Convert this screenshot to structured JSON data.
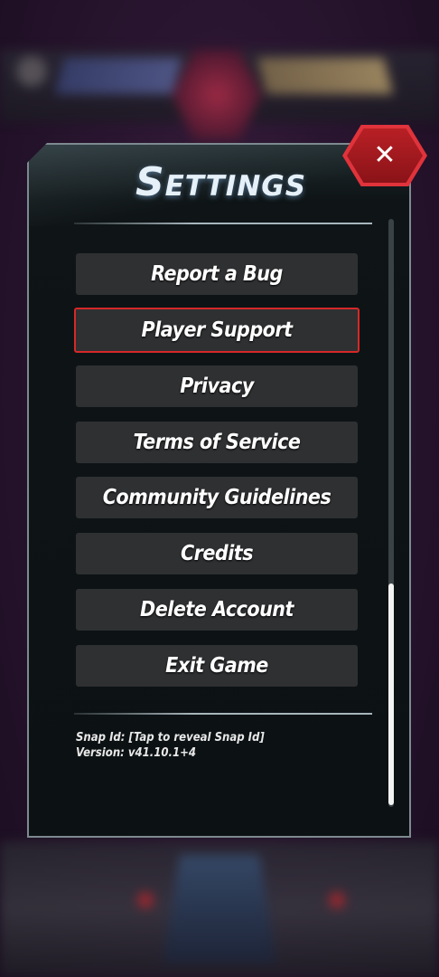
{
  "settings": {
    "title": "Settings",
    "close_symbol": "✕",
    "menu": [
      {
        "label": "Report a Bug",
        "selected": false
      },
      {
        "label": "Player Support",
        "selected": true
      },
      {
        "label": "Privacy",
        "selected": false
      },
      {
        "label": "Terms of Service",
        "selected": false
      },
      {
        "label": "Community Guidelines",
        "selected": false
      },
      {
        "label": "Credits",
        "selected": false
      },
      {
        "label": "Delete Account",
        "selected": false
      },
      {
        "label": "Exit Game",
        "selected": false
      }
    ],
    "snap_id": "Snap Id: [Tap to reveal Snap Id]",
    "version": "Version: v41.10.1+4",
    "accent_color": "#d62828"
  }
}
